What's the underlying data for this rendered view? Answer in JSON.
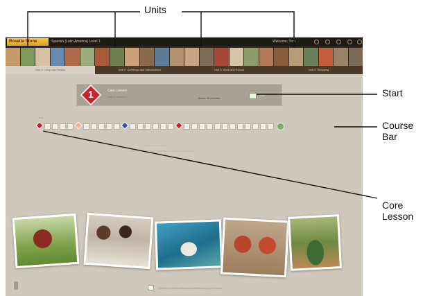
{
  "annotations": {
    "units": "Units",
    "start": "Start",
    "course_bar": "Course Bar",
    "core_lesson": "Core Lesson"
  },
  "app": {
    "logo": "Rosetta Stone",
    "course_title": "Spanish (Latin America) Level 1",
    "welcome": "Welcome, Tom",
    "tabs": [
      {
        "label": "Unit 1: Language Basics"
      },
      {
        "label": "Unit 2: Greetings and Introductions"
      },
      {
        "label": "Unit 3: Work and School"
      },
      {
        "label": "Unit 4: Shopping"
      }
    ],
    "start_panel": {
      "lesson_number": "1",
      "title": "Core Lesson",
      "subtitle": "Unit 1, Lesson 1",
      "time": "About 30 minutes",
      "start_label": "Start"
    },
    "course_bar_label": "Core",
    "mid_text_1": "Lesson 1 Progress",
    "mid_text_2": "Click a block on the Course Bar to choose an activity",
    "bottom_text": "Click here to add Milestone activities to your Course",
    "colors": {
      "diamond_red": "#c8232c",
      "diamond_blue": "#3b4fa3",
      "diamond_peach": "#f0b48d",
      "milestone_green": "#83a86a"
    }
  }
}
